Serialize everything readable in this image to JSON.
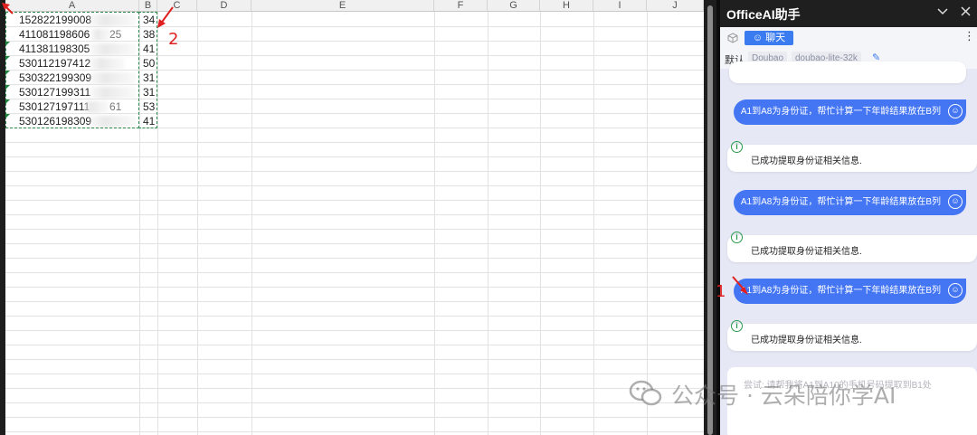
{
  "sheet": {
    "columns": [
      "A",
      "B",
      "C",
      "D",
      "E",
      "F",
      "G",
      "H",
      "I",
      "J"
    ],
    "rows": [
      {
        "a": "152822199008",
        "a_tail": "",
        "b": "34"
      },
      {
        "a": "411081198606",
        "a_tail": "25",
        "b": "38"
      },
      {
        "a": "411381198305",
        "a_tail": "",
        "b": "41"
      },
      {
        "a": "530112197412",
        "a_tail": "",
        "b": "50"
      },
      {
        "a": "530322199309",
        "a_tail": "",
        "b": "31"
      },
      {
        "a": "530127199311",
        "a_tail": "",
        "b": "31"
      },
      {
        "a": "530127197111",
        "a_tail": "61",
        "b": "53"
      },
      {
        "a": "530126198309",
        "a_tail": "",
        "b": "41"
      }
    ]
  },
  "annotations": {
    "n2": "2",
    "n1": "1"
  },
  "panel": {
    "title": "OfficeAI助手",
    "chat_button": "聊天",
    "default_label": "默认",
    "provider": "Doubao",
    "model": "doubao-lite-32k",
    "messages": [
      {
        "role": "user",
        "text": "A1到A8为身份证，帮忙计算一下年龄结果放在B列"
      },
      {
        "role": "bot",
        "text": "已成功提取身份证相关信息."
      },
      {
        "role": "user",
        "text": "A1到A8为身份证，帮忙计算一下年龄结果放在B列"
      },
      {
        "role": "bot",
        "text": "已成功提取身份证相关信息."
      },
      {
        "role": "user",
        "text": "A1到A8为身份证，帮忙计算一下年龄结果放在B列"
      },
      {
        "role": "bot",
        "text": "已成功提取身份证相关信息."
      }
    ],
    "input_placeholder": "尝试: 请帮我将A1到A10的手机号码提取到B1处"
  },
  "watermark": "公众号 · 云朵陪你学AI",
  "colors": {
    "accent": "#4476f3",
    "chat_button": "#3a7bf0",
    "info": "#2a9a4a",
    "arrow": "#e02020"
  }
}
